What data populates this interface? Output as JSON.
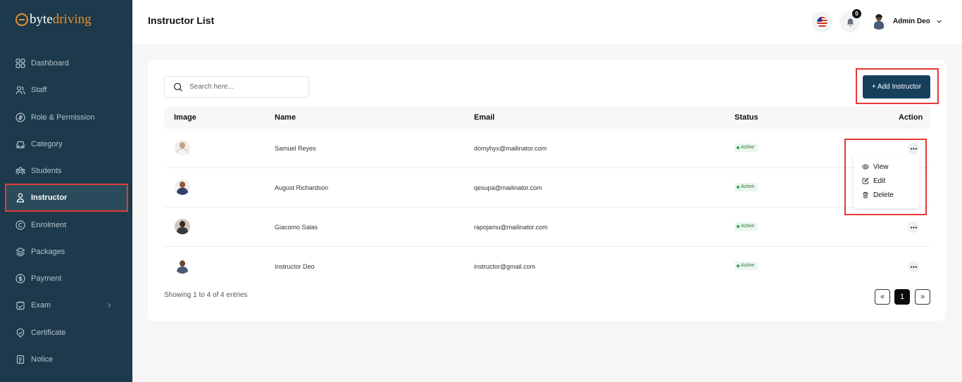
{
  "brand": {
    "part1": "byte",
    "part2": "driving"
  },
  "sidebar": {
    "items": [
      {
        "label": "Dashboard"
      },
      {
        "label": "Staff"
      },
      {
        "label": "Role & Permission"
      },
      {
        "label": "Category"
      },
      {
        "label": "Students"
      },
      {
        "label": "Instructor"
      },
      {
        "label": "Enrolment"
      },
      {
        "label": "Packages"
      },
      {
        "label": "Payment"
      },
      {
        "label": "Exam"
      },
      {
        "label": "Certificate"
      },
      {
        "label": "Notice"
      }
    ],
    "active": "Instructor"
  },
  "header": {
    "title": "Instructor List",
    "notification_count": "0",
    "user_name": "Admin Deo"
  },
  "toolbar": {
    "search_placeholder": "Search here...",
    "add_label": "+ Add Instructor"
  },
  "table": {
    "columns": [
      "Image",
      "Name",
      "Email",
      "Status",
      "Action"
    ],
    "rows": [
      {
        "name": "Samuel Reyes",
        "email": "domyhyx@mailinator.com",
        "status": "Active"
      },
      {
        "name": "August Richardson",
        "email": "qesupa@mailinator.com",
        "status": "Active"
      },
      {
        "name": "Giacomo Salas",
        "email": "rapojamu@mailinator.com",
        "status": "Active"
      },
      {
        "name": "Instructor Deo",
        "email": "instructor@gmail.com",
        "status": "Active"
      }
    ]
  },
  "action_menu": {
    "view": "View",
    "edit": "Edit",
    "delete": "Delete"
  },
  "pagination": {
    "summary": "Showing 1 to 4 of 4 entries",
    "prev": "«",
    "current": "1",
    "next": "»"
  },
  "colors": {
    "sidebar": "#1c3a4b",
    "accent": "#e8912e",
    "primary_button": "#163f5c",
    "highlight": "#e53935"
  }
}
